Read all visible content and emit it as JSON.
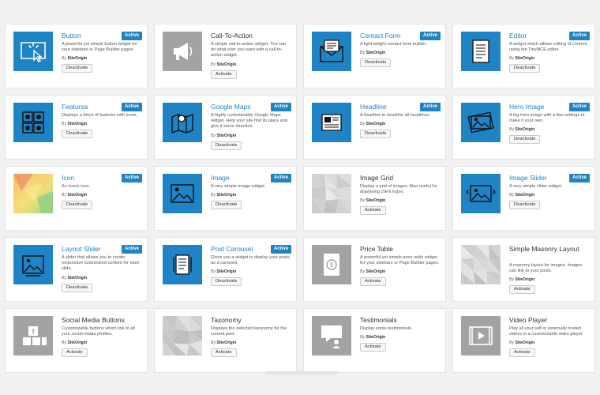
{
  "by_prefix": "By",
  "widgets": [
    {
      "name": "Button",
      "desc": "A powerful yet simple button widget for your sidebars or Page Builder pages.",
      "author": "SiteOrigin",
      "status": "Active",
      "action": "Deactivate",
      "icon": "cursor-click-icon",
      "theme": "blue"
    },
    {
      "name": "Call-To-Action",
      "desc": "A simple call-to-action widget. You can do what ever you want with a call-to-action widget.",
      "author": "SiteOrigin",
      "status": "",
      "action": "Activate",
      "icon": "megaphone-icon",
      "theme": "gray"
    },
    {
      "name": "Contact Form",
      "desc": "A light weight contact form builder.",
      "author": "SiteOrigin",
      "status": "Active",
      "action": "Deactivate",
      "icon": "envelope-icon",
      "theme": "blue"
    },
    {
      "name": "Editor",
      "desc": "A widget which allows editing of content using the TinyMCE editor.",
      "author": "SiteOrigin",
      "status": "Active",
      "action": "Deactivate",
      "icon": "document-icon",
      "theme": "blue"
    },
    {
      "name": "Features",
      "desc": "Displays a block of features with icons.",
      "author": "SiteOrigin",
      "status": "Active",
      "action": "Deactivate",
      "icon": "features-grid-icon",
      "theme": "blue"
    },
    {
      "name": "Google Maps",
      "desc": "A highly customisable Google Maps widget. Help your site find its place and give it some direction.",
      "author": "SiteOrigin",
      "status": "Active",
      "action": "Deactivate",
      "icon": "map-pin-icon",
      "theme": "blue"
    },
    {
      "name": "Headline",
      "desc": "A headline to headline all headlines.",
      "author": "SiteOrigin",
      "status": "Active",
      "action": "Deactivate",
      "icon": "newspaper-icon",
      "theme": "blue"
    },
    {
      "name": "Hero Image",
      "desc": "A big hero image with a few settings to make it your own.",
      "author": "SiteOrigin",
      "status": "Active",
      "action": "Deactivate",
      "icon": "hero-image-icon",
      "theme": "blue"
    },
    {
      "name": "Icon",
      "desc": "An iconic icon.",
      "author": "SiteOrigin",
      "status": "Active",
      "action": "Deactivate",
      "icon": "colorful-icon",
      "theme": "warm"
    },
    {
      "name": "Image",
      "desc": "A very simple image widget.",
      "author": "SiteOrigin",
      "status": "Active",
      "action": "Deactivate",
      "icon": "image-icon",
      "theme": "blue"
    },
    {
      "name": "Image Grid",
      "desc": "Display a grid of images. Also useful for displaying client logos.",
      "author": "SiteOrigin",
      "status": "",
      "action": "Activate",
      "icon": "polygon-icon",
      "theme": "poly"
    },
    {
      "name": "Image Slider",
      "desc": "A very simple slider widget.",
      "author": "SiteOrigin",
      "status": "Active",
      "action": "Deactivate",
      "icon": "image-slider-icon",
      "theme": "blue"
    },
    {
      "name": "Layout Slider",
      "desc": "A slider that allows you to create responsive columnized content for each slide.",
      "author": "SiteOrigin",
      "status": "Active",
      "action": "Deactivate",
      "icon": "layout-slider-icon",
      "theme": "blue"
    },
    {
      "name": "Post Carousel",
      "desc": "Gives you a widget to display your posts as a carousel.",
      "author": "SiteOrigin",
      "status": "Active",
      "action": "Deactivate",
      "icon": "carousel-icon",
      "theme": "blue"
    },
    {
      "name": "Price Table",
      "desc": "A powerful yet simple price table widget for your sidebars or Page Builder pages.",
      "author": "SiteOrigin",
      "status": "",
      "action": "Activate",
      "icon": "price-tag-icon",
      "theme": "gray"
    },
    {
      "name": "Simple Masonry Layout",
      "desc": "A masonry layout for images. Images can link to your posts.",
      "author": "SiteOrigin",
      "status": "",
      "action": "Activate",
      "icon": "polygon-icon",
      "theme": "poly"
    },
    {
      "name": "Social Media Buttons",
      "desc": "Customizable buttons which link to all your social media profiles.",
      "author": "SiteOrigin",
      "status": "",
      "action": "Activate",
      "icon": "social-icon",
      "theme": "gray"
    },
    {
      "name": "Taxonomy",
      "desc": "Displays the selected taxonomy for the current post.",
      "author": "SiteOrigin",
      "status": "",
      "action": "Activate",
      "icon": "polygon-icon",
      "theme": "poly"
    },
    {
      "name": "Testimonials",
      "desc": "Display some testimonials.",
      "author": "SiteOrigin",
      "status": "",
      "action": "Activate",
      "icon": "testimonial-icon",
      "theme": "gray"
    },
    {
      "name": "Video Player",
      "desc": "Play all your self or externally hosted videos in a customizable video player.",
      "author": "SiteOrigin",
      "status": "",
      "action": "Activate",
      "icon": "video-player-icon",
      "theme": "gray"
    }
  ]
}
